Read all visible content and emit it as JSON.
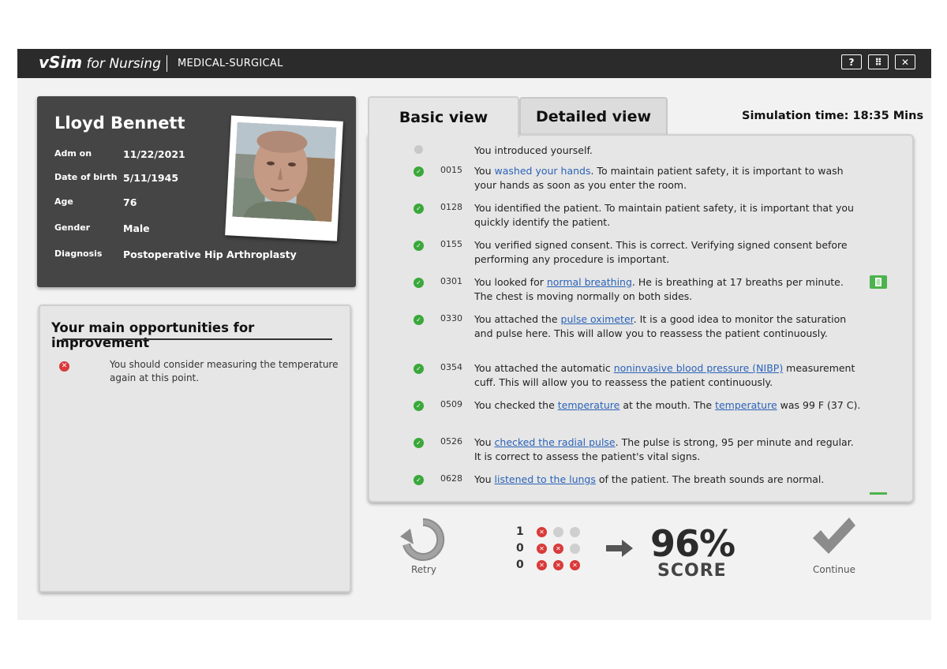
{
  "app": {
    "brand_main": "vSim",
    "brand_sub": " for Nursing",
    "section": "MEDICAL-SURGICAL",
    "window_buttons": [
      {
        "label": "?",
        "icon": "help-icon"
      },
      {
        "label": "⠿",
        "icon": "fullscreen-icon"
      },
      {
        "label": "✕",
        "icon": "close-icon"
      }
    ]
  },
  "patient": {
    "name": "Lloyd Bennett",
    "fields": [
      {
        "label": "Adm on",
        "value": "11/22/2021"
      },
      {
        "label": "Date of birth",
        "value": "5/11/1945"
      },
      {
        "label": "Age",
        "value": "76"
      },
      {
        "label": "Gender",
        "value": "Male"
      },
      {
        "label": "Diagnosis",
        "value": "Postoperative Hip Arthroplasty"
      }
    ]
  },
  "improvement": {
    "title": "Your main opportunities for improvement",
    "items": [
      {
        "text": "You should consider measuring the temperature again at this point."
      }
    ]
  },
  "tabs": {
    "basic": "Basic view",
    "detailed": "Detailed view"
  },
  "simulation_time": "Simulation time: 18:35 Mins",
  "log": [
    {
      "status": "neutral",
      "time": "",
      "parts": [
        {
          "t": "You introduced yourself."
        }
      ]
    },
    {
      "status": "ok",
      "time": "0015",
      "parts": [
        {
          "t": "You "
        },
        {
          "t": "washed your hands",
          "link": "plain"
        },
        {
          "t": ". To maintain patient safety, it is important to wash your hands as soon as you enter the room."
        }
      ]
    },
    {
      "status": "ok",
      "time": "0128",
      "parts": [
        {
          "t": "You identified the patient. To maintain patient safety, it is important that you quickly identify the patient."
        }
      ]
    },
    {
      "status": "ok",
      "time": "0155",
      "parts": [
        {
          "t": "You verified signed consent. This is correct. Verifying signed consent before performing any procedure is important."
        }
      ]
    },
    {
      "status": "ok",
      "time": "0301",
      "note": true,
      "parts": [
        {
          "t": "You looked for "
        },
        {
          "t": "normal breathing",
          "link": "underline"
        },
        {
          "t": ". He is breathing at 17 breaths per minute. The chest is moving normally on both sides."
        }
      ]
    },
    {
      "status": "ok",
      "time": "0330",
      "parts": [
        {
          "t": "You attached the "
        },
        {
          "t": "pulse oximeter",
          "link": "underline"
        },
        {
          "t": ". It is a good idea to monitor the saturation and pulse here. This will allow you to reassess the patient continuously."
        }
      ]
    },
    {
      "status": "ok",
      "time": "0354",
      "parts": [
        {
          "t": "You attached the automatic "
        },
        {
          "t": "noninvasive blood pressure (NIBP)",
          "link": "underline"
        },
        {
          "t": " measurement cuff. This will allow you to reassess the patient continuously."
        }
      ]
    },
    {
      "status": "ok",
      "time": "0509",
      "parts": [
        {
          "t": "You checked the "
        },
        {
          "t": "temperature",
          "link": "underline"
        },
        {
          "t": " at the mouth. The "
        },
        {
          "t": "temperature",
          "link": "underline"
        },
        {
          "t": " was 99 F (37 C)."
        }
      ]
    },
    {
      "status": "ok",
      "time": "0526",
      "parts": [
        {
          "t": "You "
        },
        {
          "t": "checked the radial pulse",
          "link": "underline"
        },
        {
          "t": ". The pulse is strong, 95 per minute and regular. It is correct to assess the patient's vital signs."
        }
      ]
    },
    {
      "status": "ok",
      "time": "0628",
      "parts": [
        {
          "t": "You "
        },
        {
          "t": "listened to the lungs",
          "link": "underline"
        },
        {
          "t": " of the patient. The breath sounds are normal."
        }
      ]
    }
  ],
  "results": {
    "retry_label": "Retry",
    "continue_label": "Continue",
    "score_value": "96%",
    "score_label": "SCORE",
    "rows": [
      {
        "count": "1",
        "dots": [
          "red",
          "grey",
          "grey"
        ]
      },
      {
        "count": "0",
        "dots": [
          "red",
          "red",
          "grey"
        ]
      },
      {
        "count": "0",
        "dots": [
          "red",
          "red",
          "red"
        ]
      }
    ]
  },
  "colors": {
    "topbar": "#2b2b2b",
    "link": "#2b63b8",
    "ok": "#3aa83a",
    "error": "#d93a3a"
  }
}
